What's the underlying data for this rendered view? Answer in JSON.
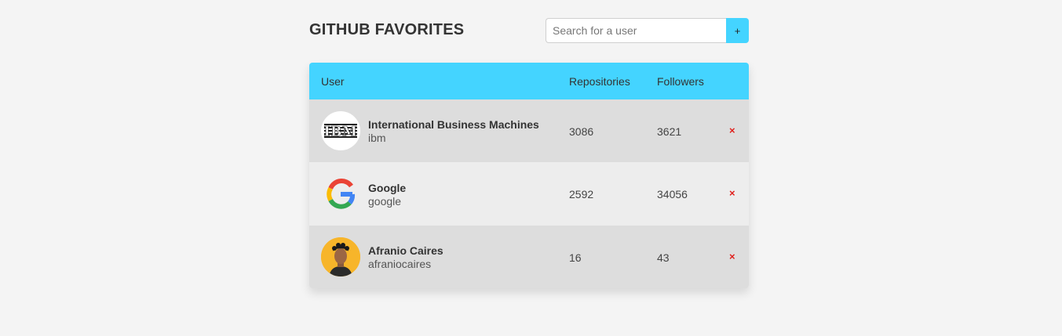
{
  "header": {
    "title": "GITHUB FAVORITES"
  },
  "search": {
    "placeholder": "Search for a user",
    "value": "",
    "add_label": "+"
  },
  "table": {
    "columns": [
      "User",
      "Repositories",
      "Followers"
    ],
    "remove_label": "×",
    "rows": [
      {
        "name": "International Business Machines",
        "login": "ibm",
        "repositories": "3086",
        "followers": "3621",
        "avatar_icon": "ibm-logo-icon"
      },
      {
        "name": "Google",
        "login": "google",
        "repositories": "2592",
        "followers": "34056",
        "avatar_icon": "google-logo-icon"
      },
      {
        "name": "Afranio Caires",
        "login": "afraniocaires",
        "repositories": "16",
        "followers": "43",
        "avatar_icon": "person-avatar-icon"
      }
    ]
  },
  "colors": {
    "accent": "#44d4ff",
    "remove": "#e0201c",
    "row_dark": "#dddddd",
    "row_light": "#ededed",
    "background": "#f4f4f4"
  }
}
